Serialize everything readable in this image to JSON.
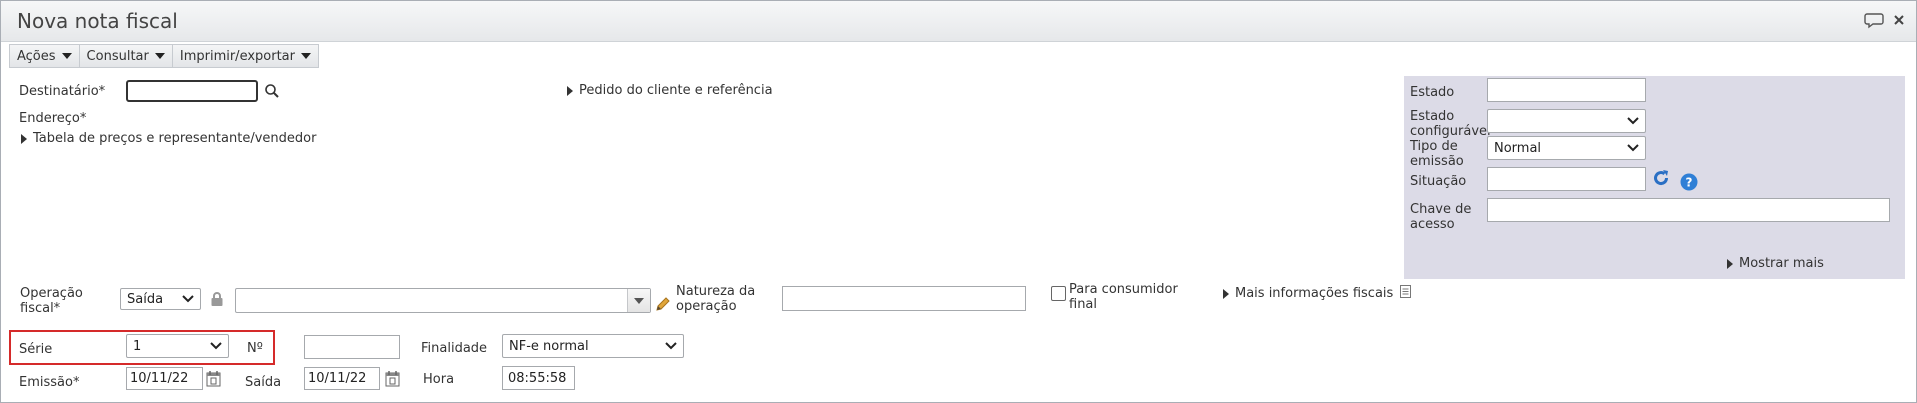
{
  "window": {
    "title": "Nova nota fiscal"
  },
  "toolbar": {
    "acoes": "Ações",
    "consultar": "Consultar",
    "imprimir": "Imprimir/exportar"
  },
  "left": {
    "destinatario_label": "Destinatário*",
    "destinatario_value": "",
    "pedido_link": "Pedido do cliente e referência",
    "endereco_label": "Endereço*",
    "tabela_link": "Tabela de preços e representante/vendedor"
  },
  "right": {
    "estado_label": "Estado",
    "estado_value": "",
    "estado_conf_label1": "Estado",
    "estado_conf_label2": "configurável",
    "estado_conf_value": "",
    "tipo_label1": "Tipo de",
    "tipo_label2": "emissão",
    "tipo_value": "Normal",
    "situacao_label": "Situação",
    "situacao_value": "",
    "chave_label1": "Chave de",
    "chave_label2": "acesso",
    "chave_value": "",
    "mostrar_mais": "Mostrar mais"
  },
  "operacao": {
    "label1": "Operação",
    "label2": "fiscal*",
    "tipo_value": "Saída",
    "value": "",
    "natureza_label1": "Natureza da",
    "natureza_label2": "operação",
    "natureza_value": "",
    "consumidor_label1": "Para consumidor",
    "consumidor_label2": "final",
    "consumidor_checked": false,
    "mais_info_link": "Mais informações fiscais"
  },
  "serie": {
    "label": "Série",
    "value": "1",
    "numero_label": "Nº",
    "numero_value": "",
    "finalidade_label": "Finalidade",
    "finalidade_value": "NF-e normal"
  },
  "datas": {
    "emissao_label": "Emissão*",
    "emissao_value": "10/11/22",
    "saida_label": "Saída",
    "saida_value": "10/11/22",
    "hora_label": "Hora",
    "hora_value": "08:55:58"
  }
}
